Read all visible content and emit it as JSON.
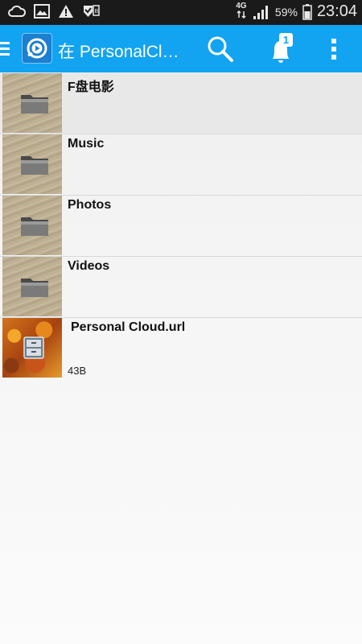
{
  "status_bar": {
    "network": "4G",
    "battery_percent": "59%",
    "time": "23:04",
    "left_icons": [
      "cloud-icon",
      "image-icon",
      "warning-icon",
      "security-check-icon"
    ],
    "right_icons": [
      "data-transfer-icon",
      "signal-icon",
      "battery-icon"
    ]
  },
  "action_bar": {
    "title": "在 PersonalCl…",
    "notification_count": "1",
    "colors": {
      "background": "#12a3f1",
      "text": "#ffffff"
    }
  },
  "files": [
    {
      "name": "F盘电影",
      "type": "folder",
      "size": ""
    },
    {
      "name": "Music",
      "type": "folder",
      "size": ""
    },
    {
      "name": "Photos",
      "type": "folder",
      "size": ""
    },
    {
      "name": "Videos",
      "type": "folder",
      "size": ""
    },
    {
      "name": "Personal Cloud.url",
      "type": "file",
      "size": "43B"
    }
  ]
}
